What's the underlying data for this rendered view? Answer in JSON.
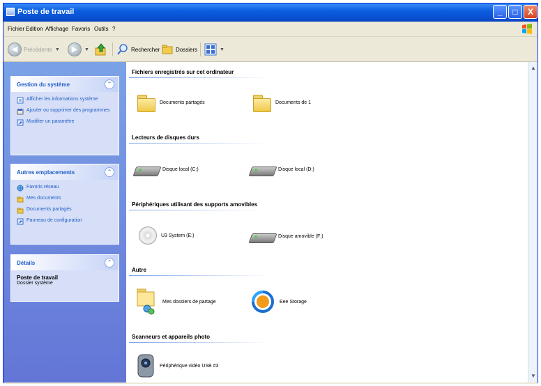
{
  "window": {
    "title": "Poste de travail",
    "buttons": {
      "minimize": "_",
      "maximize": "□",
      "close": "X"
    }
  },
  "menubar": {
    "items": [
      "Fichier",
      "Edition",
      "Affichage",
      "Favoris",
      "Outils",
      "?"
    ]
  },
  "toolbar": {
    "back_label": "Précédente",
    "back_icon": "back-arrow-icon",
    "forward_icon": "forward-arrow-icon",
    "up_icon": "up-folder-icon",
    "search_label": "Rechercher",
    "folders_label": "Dossiers",
    "views_icon": "views-icon"
  },
  "sidebar": {
    "system_tasks": {
      "title": "Gestion du système",
      "items": [
        {
          "label": "Afficher les informations système",
          "icon": "system-info-icon"
        },
        {
          "label": "Ajouter ou supprimer des programmes",
          "icon": "add-remove-icon"
        },
        {
          "label": "Modifier un paramètre",
          "icon": "control-panel-icon"
        }
      ]
    },
    "other_places": {
      "title": "Autres emplacements",
      "items": [
        {
          "label": "Favoris réseau",
          "icon": "network-icon"
        },
        {
          "label": "Mes documents",
          "icon": "my-documents-icon"
        },
        {
          "label": "Documents partagés",
          "icon": "shared-folder-icon"
        },
        {
          "label": "Panneau de configuration",
          "icon": "control-panel-icon"
        }
      ]
    },
    "details": {
      "title": "Détails",
      "item_title": "Poste de travail",
      "item_subtitle": "Dossier système"
    }
  },
  "content": {
    "groups": [
      {
        "title": "Fichiers enregistrés sur cet ordinateur",
        "items": [
          {
            "label": "Documents partagés",
            "icon": "folder-icon"
          },
          {
            "label": "Documents de 1",
            "icon": "folder-icon"
          }
        ]
      },
      {
        "title": "Lecteurs de disques durs",
        "items": [
          {
            "label": "Disque local (C:)",
            "icon": "hard-drive-icon"
          },
          {
            "label": "Disque local (D:)",
            "icon": "hard-drive-icon"
          }
        ]
      },
      {
        "title": "Périphériques utilisant des supports amovibles",
        "items": [
          {
            "label": "U3 System (E:)",
            "icon": "cd-drive-icon"
          },
          {
            "label": "Disque amovible (F:)",
            "icon": "removable-disk-icon"
          }
        ]
      },
      {
        "title": "Autre",
        "items": [
          {
            "label": "Mes dossiers de partage",
            "icon": "shared-folder-icon"
          },
          {
            "label": "Eee Storage",
            "icon": "eee-storage-icon"
          }
        ]
      },
      {
        "title": "Scanneurs et appareils photo",
        "items": [
          {
            "label": "Périphérique vidéo USB #3",
            "icon": "webcam-icon"
          }
        ]
      }
    ]
  },
  "colors": {
    "titlebar": "#0a4fd0",
    "sidebar": "#6375d6",
    "panel": "#d6dff7",
    "link": "#215dc6"
  }
}
